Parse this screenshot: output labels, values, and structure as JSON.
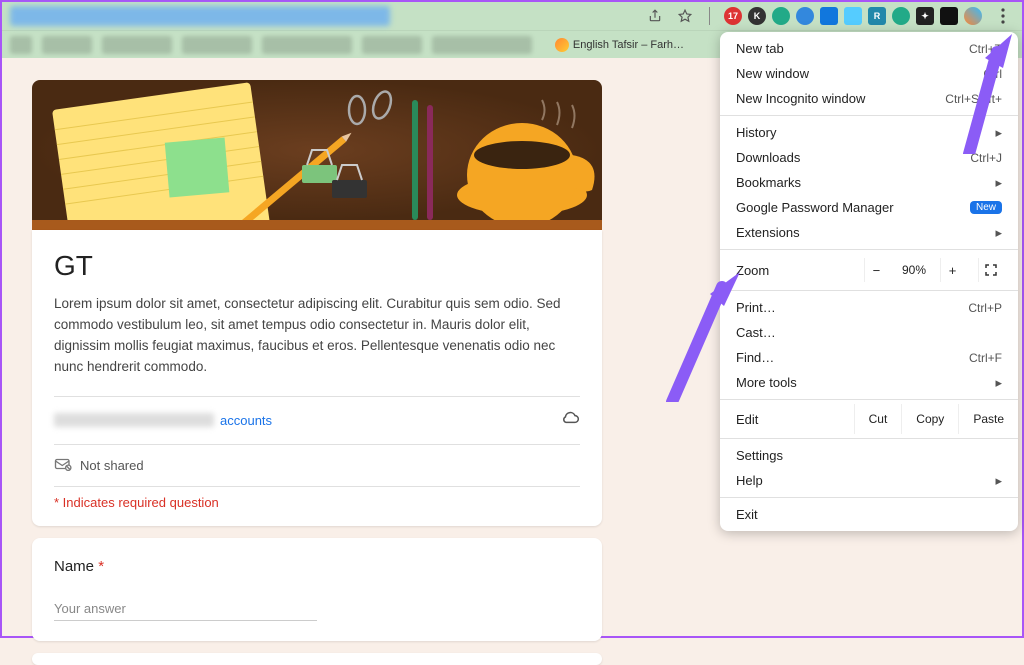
{
  "chrome": {
    "tab_title": "English Tafsir – Farh…"
  },
  "menu": {
    "new_tab": {
      "label": "New tab",
      "shortcut": "Ctrl+T"
    },
    "new_window": {
      "label": "New window",
      "shortcut": "Ctrl"
    },
    "incognito": {
      "label": "New Incognito window",
      "shortcut": "Ctrl+Shift+"
    },
    "history": {
      "label": "History"
    },
    "downloads": {
      "label": "Downloads",
      "shortcut": "Ctrl+J"
    },
    "bookmarks": {
      "label": "Bookmarks"
    },
    "password": {
      "label": "Google Password Manager",
      "badge": "New"
    },
    "extensions": {
      "label": "Extensions"
    },
    "zoom": {
      "label": "Zoom",
      "value": "90%"
    },
    "print": {
      "label": "Print…",
      "shortcut": "Ctrl+P"
    },
    "cast": {
      "label": "Cast…"
    },
    "find": {
      "label": "Find…",
      "shortcut": "Ctrl+F"
    },
    "more_tools": {
      "label": "More tools"
    },
    "edit": {
      "label": "Edit",
      "cut": "Cut",
      "copy": "Copy",
      "paste": "Paste"
    },
    "settings": {
      "label": "Settings"
    },
    "help": {
      "label": "Help"
    },
    "exit": {
      "label": "Exit"
    }
  },
  "form": {
    "title": "GT",
    "description": "Lorem ipsum dolor sit amet, consectetur adipiscing elit. Curabitur quis sem odio. Sed commodo vestibulum leo, sit amet tempus odio consectetur in. Mauris dolor elit, dignissim mollis feugiat maximus, faucibus et eros. Pellentesque venenatis odio nec nunc hendrerit commodo.",
    "accounts_link": "accounts",
    "not_shared": "Not shared",
    "required_notice": "* Indicates required question",
    "q1_label": "Name",
    "q1_placeholder": "Your answer"
  }
}
